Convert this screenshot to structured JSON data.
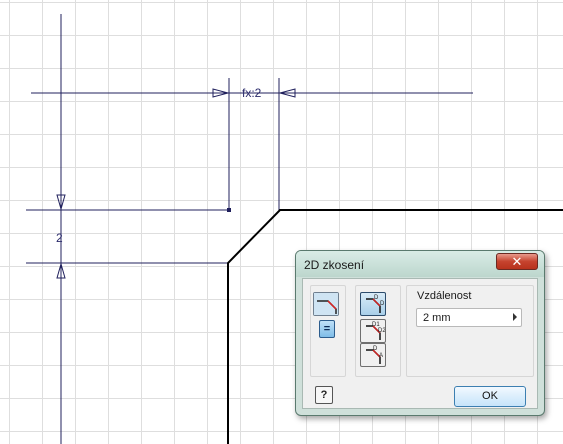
{
  "sketch": {
    "dim_horizontal_label": "fx:2",
    "dim_vertical_label": "2"
  },
  "dialog": {
    "title": "2D zkosení",
    "close_glyph": "✕",
    "distance_label": "Vzdálenost",
    "distance_value": "2 mm",
    "help_glyph": "?",
    "ok_label": "OK"
  },
  "icons": {
    "corner": "chamfer-corner-icon",
    "equal": "equal-distance-icon",
    "mode1": "chamfer-equal-distance-icon",
    "mode2": "chamfer-two-distances-icon",
    "mode3": "chamfer-distance-angle-icon"
  }
}
